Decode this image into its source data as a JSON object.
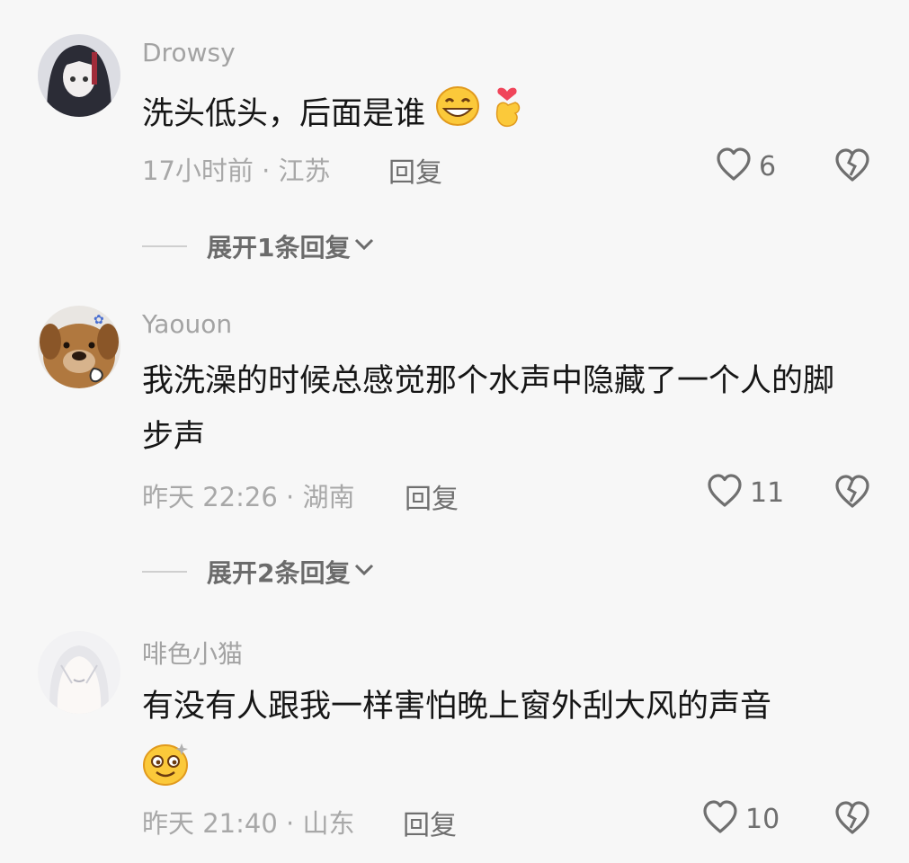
{
  "comments": [
    {
      "username": "Drowsy",
      "text": "洗头低头，后面是谁",
      "time_location": "17小时前 · 江苏",
      "reply_label": "回复",
      "like_count": "6",
      "expand_label": "展开1条回复"
    },
    {
      "username": "Yaouon",
      "text": "我洗澡的时候总感觉那个水声中隐藏了一个人的脚步声",
      "time_location": "昨天 22:26 · 湖南",
      "reply_label": "回复",
      "like_count": "11",
      "expand_label": "展开2条回复"
    },
    {
      "username": "啡色小猫",
      "text": "有没有人跟我一样害怕晚上窗外刮大风的声音",
      "time_location": "昨天 21:40 · 山东",
      "reply_label": "回复",
      "like_count": "10"
    }
  ],
  "icons": {
    "like": "heart-outline-icon",
    "dislike": "broken-heart-icon",
    "expand": "chevron-down-icon"
  },
  "colors": {
    "background": "#f7f7f7",
    "muted_text": "#a8a8a8",
    "secondary_text": "#6f6f6f"
  }
}
